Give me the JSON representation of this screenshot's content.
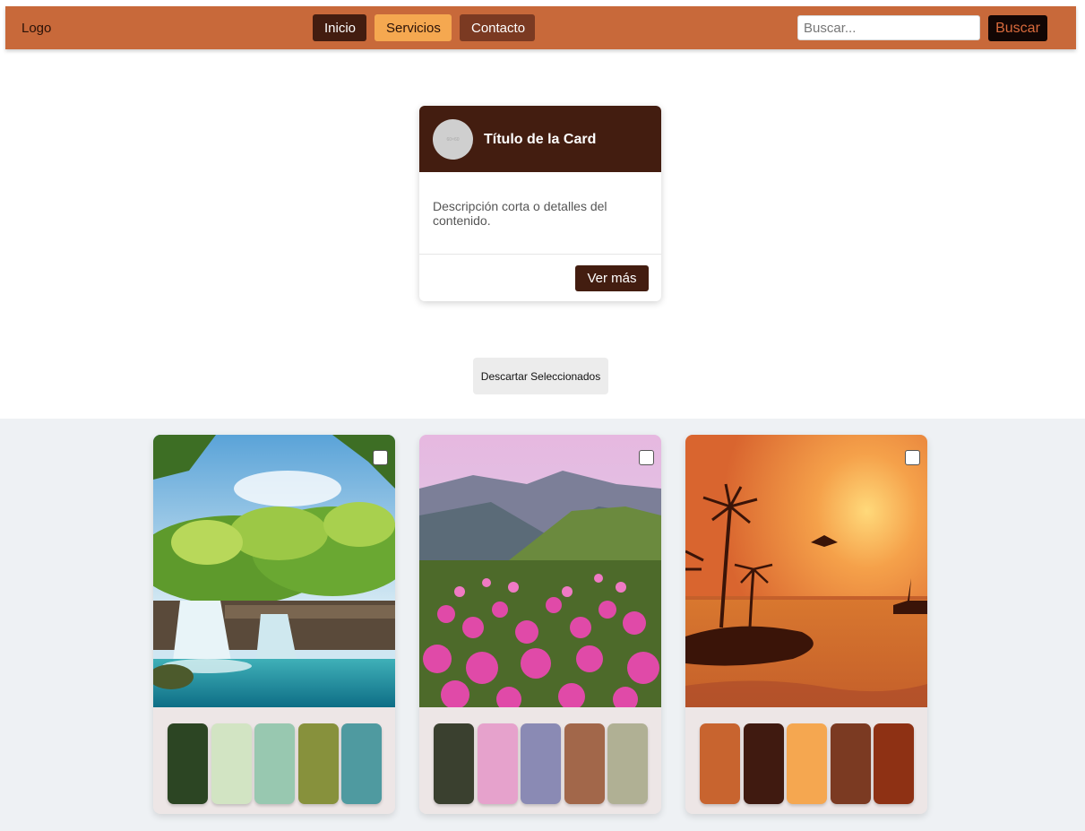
{
  "navbar": {
    "logo": "Logo",
    "links": [
      "Inicio",
      "Servicios",
      "Contacto"
    ],
    "search": {
      "placeholder": "Buscar...",
      "value": ""
    },
    "search_button": "Buscar"
  },
  "card": {
    "avatar_text": "60×60",
    "title": "Título de la Card",
    "description": "Descripción corta o detalles del contenido.",
    "button": "Ver más"
  },
  "discard_button": "Descartar Seleccionados",
  "palettes": [
    {
      "image": "waterfall-jungle",
      "selected": false,
      "colors": [
        "#2c4523",
        "#d2e4c3",
        "#98c8b0",
        "#87913c",
        "#4f9aa0"
      ]
    },
    {
      "image": "mountain-flowers",
      "selected": false,
      "colors": [
        "#3a402f",
        "#e6a2cc",
        "#8a8ab4",
        "#a2674a",
        "#b0b094"
      ]
    },
    {
      "image": "tropical-sunset",
      "selected": false,
      "colors": [
        "#c8642f",
        "#401a10",
        "#f5a750",
        "#7b3a22",
        "#8e3114"
      ]
    }
  ]
}
